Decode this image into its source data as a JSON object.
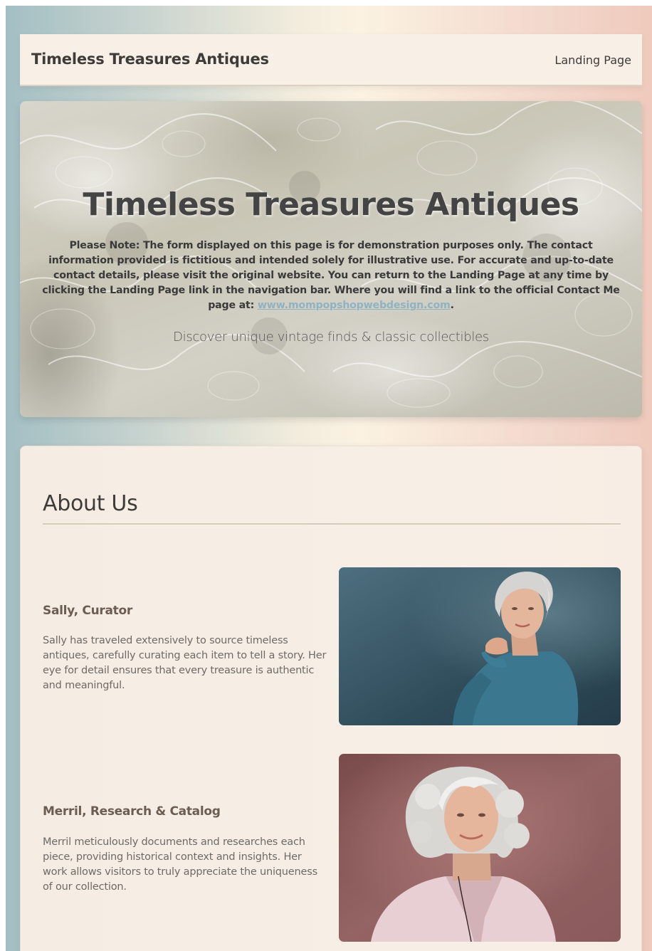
{
  "header": {
    "site_title": "Timeless Treasures Antiques",
    "nav_link": "Landing Page"
  },
  "hero": {
    "title": "Timeless Treasures Antiques",
    "note_text": "Please Note: The form displayed on this page is for demonstration purposes only. The contact information provided is fictitious and intended solely for illustrative use. For accurate and up-to-date contact details, please visit the original website. You can return to the Landing Page at any time by clicking the Landing Page link in the navigation bar. Where you will find a link to the official Contact Me page at: ",
    "note_link": "www.mompopshopwebdesign.com",
    "note_end": ".",
    "tagline": "Discover unique vintage finds & classic collectibles"
  },
  "about": {
    "heading": "About Us",
    "members": [
      {
        "name": "Sally, Curator",
        "bio": "Sally has traveled extensively to source timeless antiques, carefully curating each item to tell a story. Her eye for detail ensures that every treasure is authentic and meaningful.",
        "photo_alt": "Portrait of Sally in a teal blouse against a blue background"
      },
      {
        "name": "Merril, Research & Catalog",
        "bio": "Merril meticulously documents and researches each piece, providing historical context and insights. Her work allows visitors to truly appreciate the uniqueness of our collection.",
        "photo_alt": "Portrait of Merril in a pink blouse against a mauve background"
      }
    ]
  },
  "colors": {
    "accent_link": "#8fb3c2",
    "card_bg": "#f7efe6",
    "name_color": "#6b5d52"
  }
}
